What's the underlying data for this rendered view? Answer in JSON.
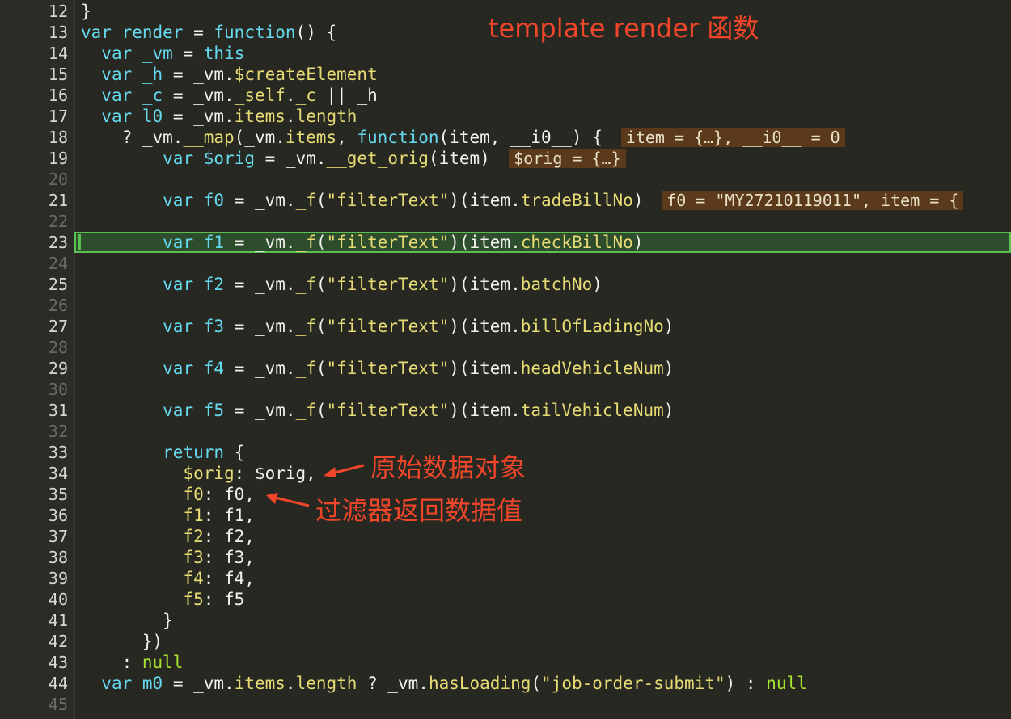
{
  "title_annotation": "template render 函数",
  "annotation_orig": "原始数据对象",
  "annotation_filter": "过滤器返回数据值",
  "lines": [
    {
      "n": "12",
      "code": "}"
    },
    {
      "n": "13",
      "code": "var render = function() {"
    },
    {
      "n": "14",
      "code": "  var _vm = this"
    },
    {
      "n": "15",
      "code": "  var _h = _vm.$createElement"
    },
    {
      "n": "16",
      "code": "  var _c = _vm._self._c || _h"
    },
    {
      "n": "17",
      "code": "  var l0 = _vm.items.length"
    },
    {
      "n": "18",
      "code": "    ? _vm.__map(_vm.items, function(item, __i0__) {",
      "chip": "item = {…}, __i0__ = 0"
    },
    {
      "n": "19",
      "code": "        var $orig = _vm.__get_orig(item)",
      "chip": "$orig = {…}"
    },
    {
      "n": "20",
      "code": ""
    },
    {
      "n": "21",
      "code": "        var f0 = _vm._f(\"filterText\")(item.tradeBillNo)",
      "chip": "f0 = \"MY27210119011\", item = {"
    },
    {
      "n": "22",
      "code": ""
    },
    {
      "n": "23",
      "code": "        var f1 = _vm._f(\"filterText\")(item.checkBillNo)"
    },
    {
      "n": "24",
      "code": ""
    },
    {
      "n": "25",
      "code": "        var f2 = _vm._f(\"filterText\")(item.batchNo)"
    },
    {
      "n": "26",
      "code": ""
    },
    {
      "n": "27",
      "code": "        var f3 = _vm._f(\"filterText\")(item.billOfLadingNo)"
    },
    {
      "n": "28",
      "code": ""
    },
    {
      "n": "29",
      "code": "        var f4 = _vm._f(\"filterText\")(item.headVehicleNum)"
    },
    {
      "n": "30",
      "code": ""
    },
    {
      "n": "31",
      "code": "        var f5 = _vm._f(\"filterText\")(item.tailVehicleNum)"
    },
    {
      "n": "32",
      "code": ""
    },
    {
      "n": "33",
      "code": "        return {"
    },
    {
      "n": "34",
      "code": "          $orig: $orig,"
    },
    {
      "n": "35",
      "code": "          f0: f0,"
    },
    {
      "n": "36",
      "code": "          f1: f1,"
    },
    {
      "n": "37",
      "code": "          f2: f2,"
    },
    {
      "n": "38",
      "code": "          f3: f3,"
    },
    {
      "n": "39",
      "code": "          f4: f4,"
    },
    {
      "n": "40",
      "code": "          f5: f5"
    },
    {
      "n": "41",
      "code": "        }"
    },
    {
      "n": "42",
      "code": "      })"
    },
    {
      "n": "43",
      "code": "    : null"
    },
    {
      "n": "44",
      "code": "  var m0 = _vm.items.length ? _vm.hasLoading(\"job-order-submit\") : null"
    },
    {
      "n": "45",
      "code": ""
    }
  ]
}
